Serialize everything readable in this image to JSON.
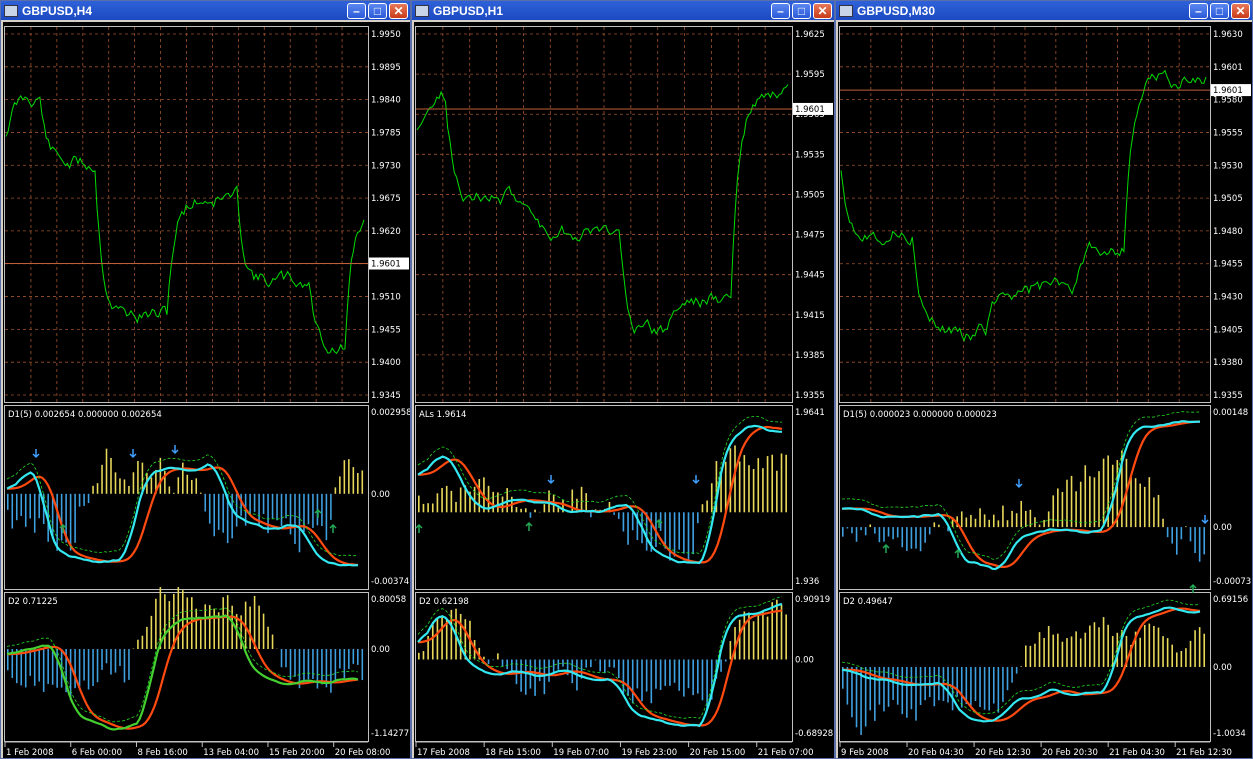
{
  "windows": [
    {
      "title": "GBPUSD,H4",
      "price": {
        "prices": [
          "1.9950",
          "1.9895",
          "1.9840",
          "1.9785",
          "1.9730",
          "1.9675",
          "1.9620",
          "1.9565",
          "1.9510",
          "1.9455",
          "1.9400",
          "1.9345"
        ],
        "current": "1.9601"
      },
      "ind1": {
        "label": "D1(5) 0.002654 0.000000 0.002654",
        "ticks": [
          "0.002958",
          "0.00",
          "-0.00374"
        ]
      },
      "ind2": {
        "label": "D2 0.71225",
        "ticks": [
          "0.80058",
          "0.00",
          "-1.14277"
        ]
      },
      "dates": [
        "1 Feb 2008",
        "6 Feb 00:00",
        "8 Feb 16:00",
        "13 Feb 04:00",
        "15 Feb 20:00",
        "20 Feb 08:00"
      ]
    },
    {
      "title": "GBPUSD,H1",
      "price": {
        "prices": [
          "1.9625",
          "1.9595",
          "1.9565",
          "1.9535",
          "1.9505",
          "1.9475",
          "1.9445",
          "1.9415",
          "1.9385",
          "1.9355"
        ],
        "current": "1.9601"
      },
      "ind1": {
        "label": "ALs 1.9614",
        "ticks": [
          "1.9641",
          "1.936"
        ]
      },
      "ind2": {
        "label": "D2 0.62198",
        "ticks": [
          "0.90919",
          "0.00",
          "-0.68928"
        ]
      },
      "dates": [
        "17 Feb 2008",
        "18 Feb 15:00",
        "19 Feb 07:00",
        "19 Feb 23:00",
        "20 Feb 15:00",
        "21 Feb 07:00"
      ]
    },
    {
      "title": "GBPUSD,M30",
      "price": {
        "prices": [
          "1.9630",
          "1.9601",
          "1.9580",
          "1.9555",
          "1.9530",
          "1.9505",
          "1.9480",
          "1.9455",
          "1.9430",
          "1.9405",
          "1.9380",
          "1.9355"
        ],
        "current": "1.9601"
      },
      "ind1": {
        "label": "D1(5) 0.000023 0.000000 0.000023",
        "ticks": [
          "0.00148",
          "0.00",
          "-0.00073"
        ]
      },
      "ind2": {
        "label": "D2 0.49647",
        "ticks": [
          "0.69156",
          "0.00",
          "-1.0034"
        ]
      },
      "dates": [
        "9 Feb 2008",
        "20 Feb 04:30",
        "20 Feb 12:30",
        "20 Feb 20:30",
        "21 Feb 04:30",
        "21 Feb 12:30"
      ]
    }
  ],
  "icons": {
    "minimize": "minimize-icon",
    "maximize": "maximize-icon",
    "close": "close-icon",
    "window": "chart-window-icon"
  },
  "colors": {
    "price": "#00dd00",
    "grid": "#a0522d",
    "hist_pos": "#e8d85a",
    "hist_neg": "#3fa0e0",
    "fast": "#33e8f0",
    "slow": "#ff4a10",
    "signal": "#22dd22",
    "arrow_down": "#3fa0ff",
    "arrow_up": "#22aa55"
  }
}
